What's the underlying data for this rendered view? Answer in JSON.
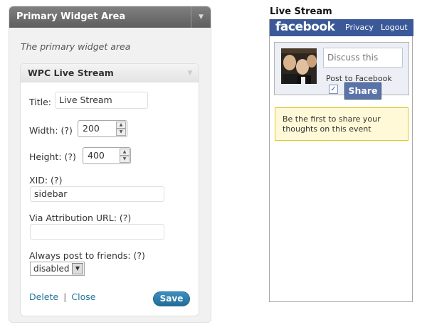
{
  "wp": {
    "panel_title": "Primary Widget Area",
    "panel_description": "The primary widget area",
    "widget": {
      "title": "WPC Live Stream",
      "fields": {
        "title_label": "Title:",
        "title_value": "Live Stream",
        "width_label": "Width: (?)",
        "width_value": "200",
        "height_label": "Height: (?)",
        "height_value": "400",
        "xid_label": "XID: (?)",
        "xid_value": "sidebar",
        "via_label": "Via Attribution URL: (?)",
        "via_value": "",
        "always_post_label": "Always post to friends: (?)",
        "always_post_value": "disabled"
      },
      "footer": {
        "delete_label": "Delete",
        "separator": "|",
        "close_label": "Close",
        "save_label": "Save"
      }
    }
  },
  "fb": {
    "section_title": "Live Stream",
    "logo_text": "facebook",
    "nav": {
      "privacy": "Privacy",
      "logout": "Logout"
    },
    "compose": {
      "placeholder": "Discuss this",
      "post_to_label": "Post to Facebook",
      "post_to_checked": true,
      "share_label": "Share"
    },
    "notice": "Be the first to share your thoughts on this event"
  },
  "colors": {
    "wp_header": "#6d6d6d",
    "wp_link": "#21759b",
    "wp_save": "#21759b",
    "fb_blue": "#3b5998",
    "fb_notice_bg": "#fff9d7",
    "fb_notice_border": "#e2c822"
  },
  "icons": {
    "wp_toggle": "triangle-down-icon",
    "spinner_up": "triangle-up-icon",
    "spinner_down": "triangle-down-icon",
    "select_arrow": "triangle-down-icon",
    "checkbox": "checkmark-icon"
  }
}
